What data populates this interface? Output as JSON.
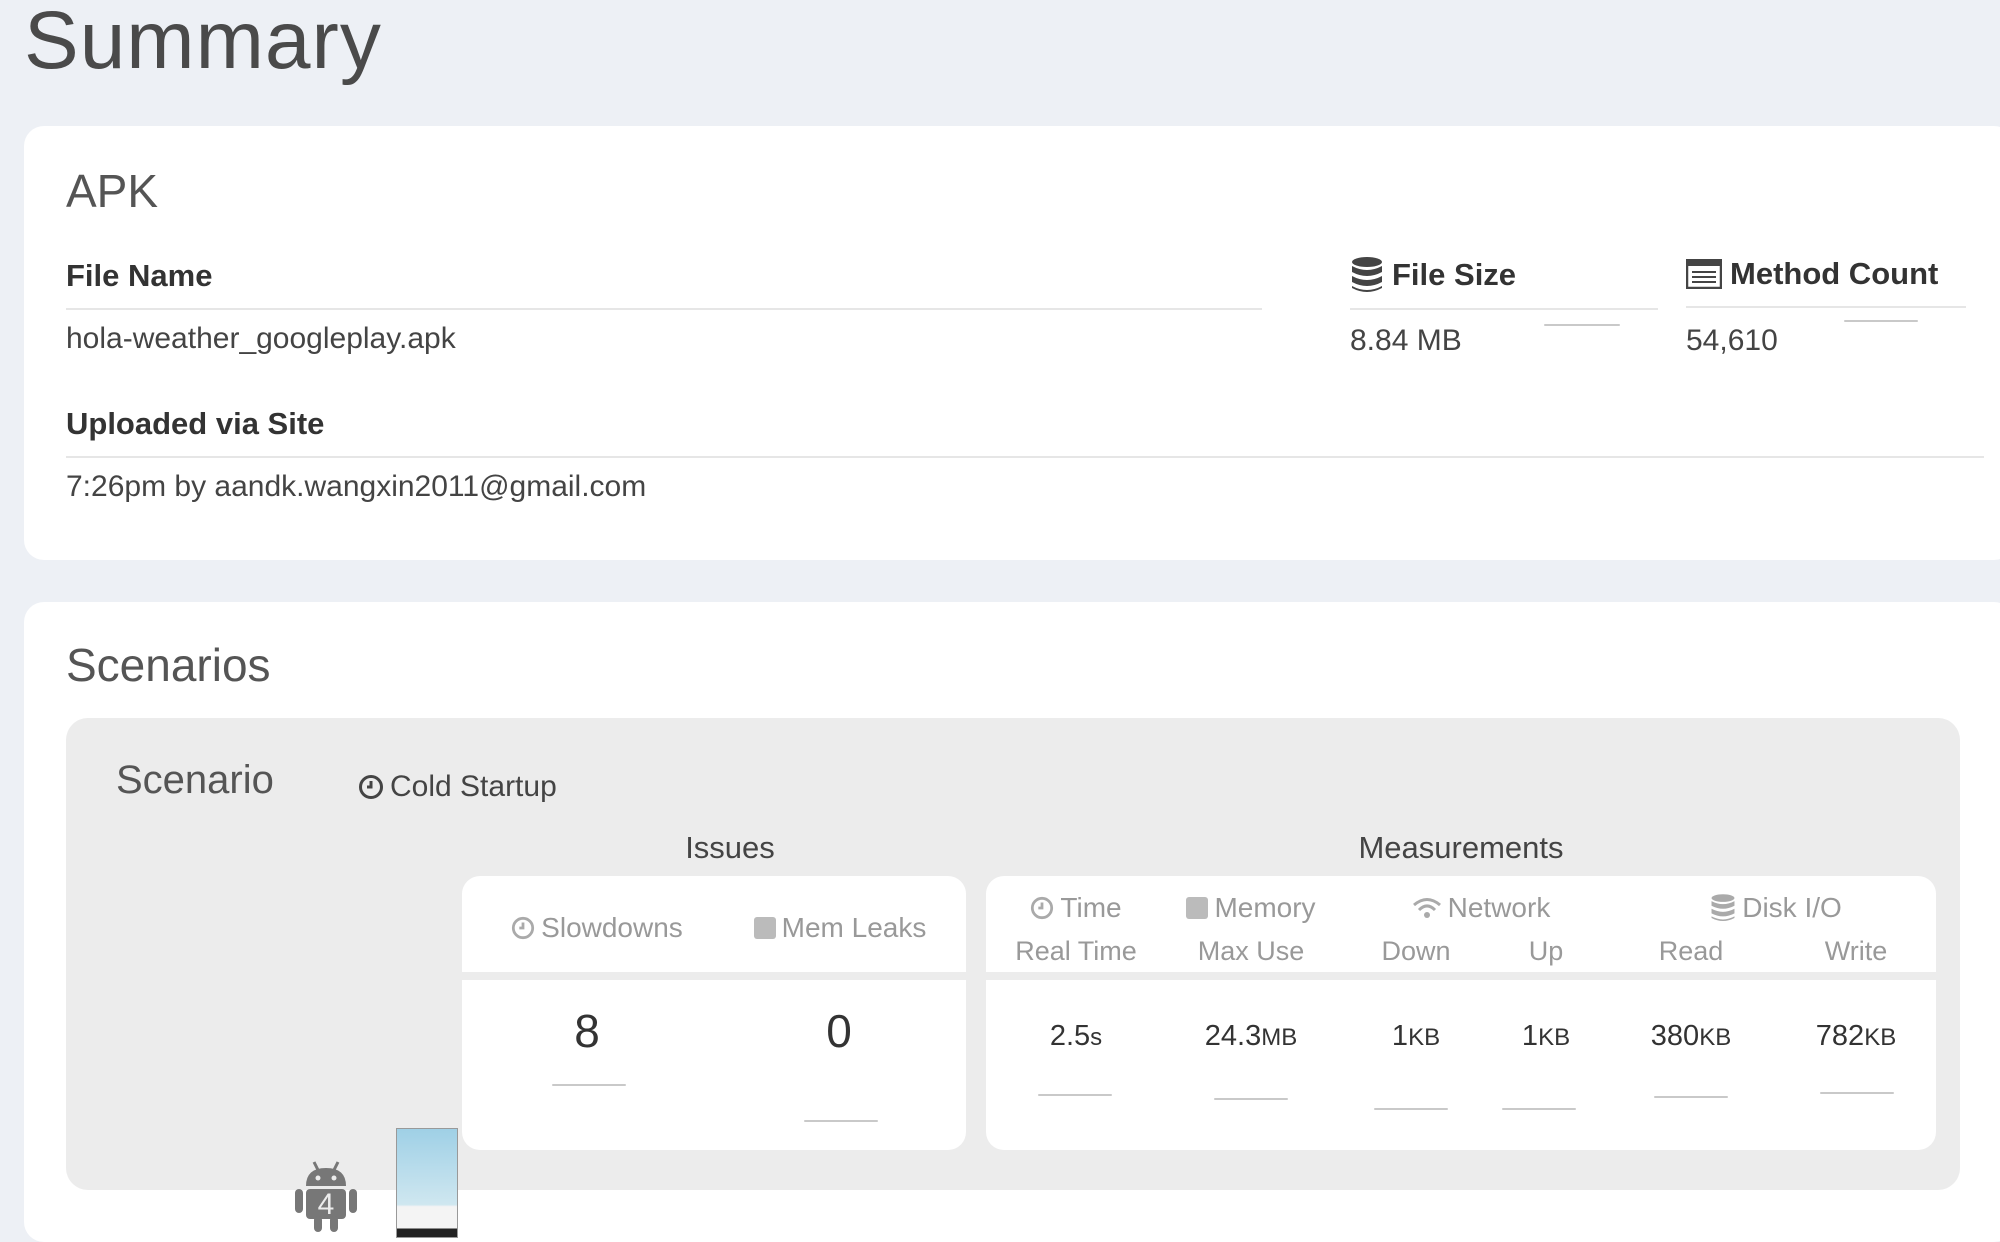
{
  "page": {
    "title": "Summary"
  },
  "apk": {
    "title": "APK",
    "file_name_label": "File Name",
    "file_name": "hola-weather_googleplay.apk",
    "file_size_label": "File Size",
    "file_size": "8.84 MB",
    "method_count_label": "Method Count",
    "method_count": "54,610",
    "uploaded_label": "Uploaded via Site",
    "uploaded_value": "7:26pm by aandk.wangxin2011@gmail.com"
  },
  "scenarios": {
    "title": "Scenarios",
    "scenario_label": "Scenario",
    "scenario_type": "Cold Startup",
    "device_api": "4",
    "issues": {
      "heading": "Issues",
      "slowdowns_label": "Slowdowns",
      "slowdowns_value": "8",
      "mem_leaks_label": "Mem Leaks",
      "mem_leaks_value": "0"
    },
    "measurements": {
      "heading": "Measurements",
      "time_label": "Time",
      "time_sub": "Real Time",
      "time_value": "2.5",
      "time_unit": "s",
      "memory_label": "Memory",
      "memory_sub": "Max Use",
      "memory_value": "24.3",
      "memory_unit": "MB",
      "network_label": "Network",
      "down_label": "Down",
      "down_value": "1",
      "down_unit": "KB",
      "up_label": "Up",
      "up_value": "1",
      "up_unit": "KB",
      "disk_label": "Disk I/O",
      "read_label": "Read",
      "read_value": "380",
      "read_unit": "KB",
      "write_label": "Write",
      "write_value": "782",
      "write_unit": "KB"
    }
  }
}
